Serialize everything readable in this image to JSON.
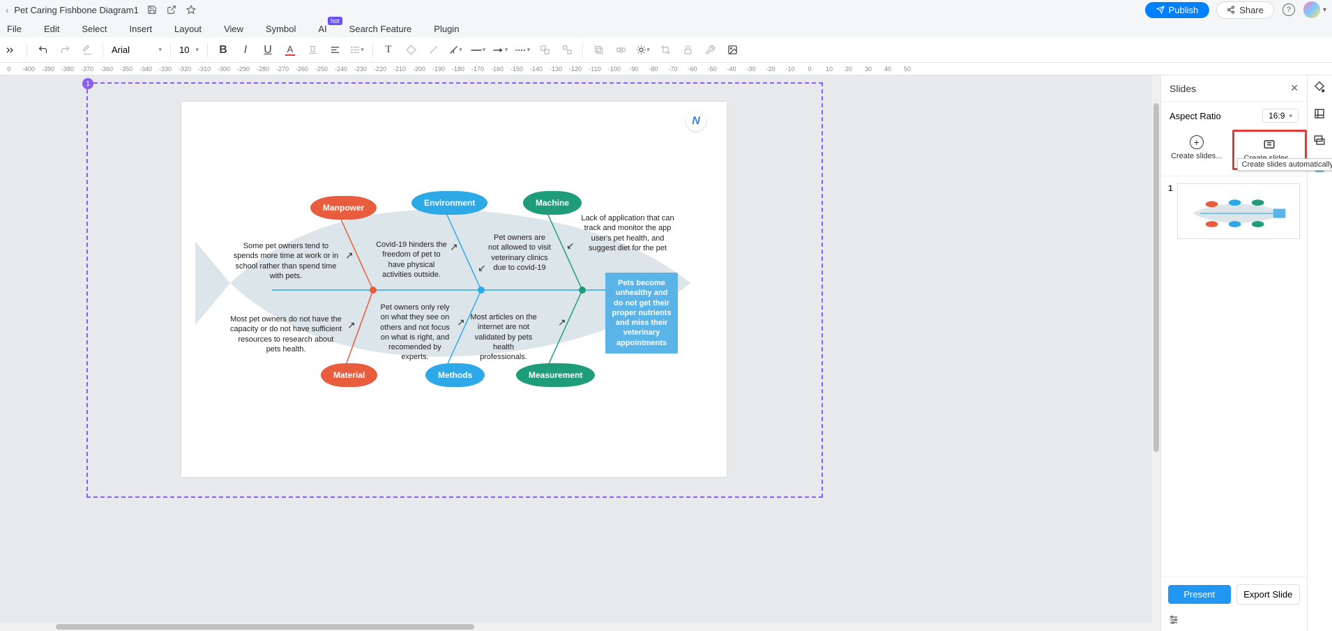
{
  "title_bar": {
    "doc_title": "Pet Caring Fishbone Diagram1",
    "publish": "Publish",
    "share": "Share"
  },
  "menu": {
    "file": "File",
    "edit": "Edit",
    "select": "Select",
    "insert": "Insert",
    "layout": "Layout",
    "view": "View",
    "symbol": "Symbol",
    "ai": "AI",
    "ai_badge": "hot",
    "search": "Search Feature",
    "plugin": "Plugin"
  },
  "toolbar": {
    "font": "Arial",
    "size": "10"
  },
  "ruler_marks": [
    "0",
    "-400",
    "-390",
    "-380",
    "-370",
    "-360",
    "-350",
    "-340",
    "-330",
    "-320",
    "-310",
    "-300",
    "-290",
    "-280",
    "-270",
    "-260",
    "-250",
    "-240",
    "-230",
    "-220",
    "-210",
    "-200",
    "-190",
    "-180",
    "-170",
    "-160",
    "-150",
    "-140",
    "-130",
    "-120",
    "-110",
    "-100",
    "-90",
    "-80",
    "-70",
    "-60",
    "-50",
    "-40",
    "-30",
    "-20",
    "-10",
    "0",
    "10",
    "20",
    "30",
    "40",
    "50"
  ],
  "fishbone": {
    "causes_top": {
      "manpower": "Manpower",
      "environment": "Environment",
      "machine": "Machine"
    },
    "causes_bottom": {
      "material": "Material",
      "methods": "Methods",
      "measurement": "Measurement"
    },
    "texts": {
      "manpower_text": "Some pet owners tend to spends more time at work or in school rather than spend time with pets.",
      "environment_text": "Covid-19 hinders the freedom of pet to have physical activities outside.",
      "machine_text_a": "Pet owners are not allowed to visit veterinary clinics due to covid-19",
      "machine_text_b": "Lack of application that can track and monitor the app user's pet health, and suggest diet for the pet",
      "material_text": "Most pet owners do not have the capacity or do not have sufficient resources to research about pets health.",
      "methods_text": "Pet owners only rely on what they see on others and not focus on what is right, and recomended by experts.",
      "measurement_text": "Most articles on the internet are not validated by pets health professionals."
    },
    "effect": "Pets become unhealthy and do not get their proper nutrients and miss their veterinary appointments"
  },
  "selection_handle": "1",
  "panel": {
    "title": "Slides",
    "aspect_label": "Aspect Ratio",
    "aspect_value": "16:9",
    "create_template": "Create slides...",
    "create_auto": "Create slides...",
    "tooltip": "Create slides automatically",
    "thumb_num": "1",
    "present": "Present",
    "export": "Export Slide"
  }
}
